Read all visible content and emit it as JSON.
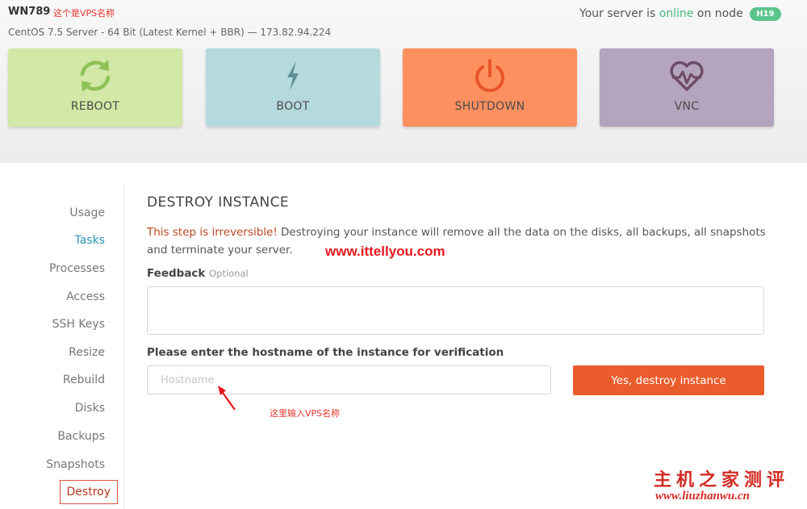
{
  "header": {
    "vps_name": "WN789",
    "vps_name_note": "这个是VPS名称",
    "os_line": "CentOS 7.5 Server - 64 Bit (Latest Kernel + BBR) — 173.82.94.224",
    "status_prefix": "Your server is",
    "status_value": "online",
    "status_suffix": "on node",
    "node": "H19"
  },
  "actions": [
    {
      "label": "REBOOT",
      "icon": "reboot-icon",
      "color": "#d2e8a6"
    },
    {
      "label": "BOOT",
      "icon": "lightning-icon",
      "color": "#b5dade"
    },
    {
      "label": "SHUTDOWN",
      "icon": "power-icon",
      "color": "#fe9060"
    },
    {
      "label": "VNC",
      "icon": "heart-monitor-icon",
      "color": "#b4a4bd"
    }
  ],
  "sidebar": {
    "items": [
      "Usage",
      "Tasks",
      "Processes",
      "Access",
      "SSH Keys",
      "Resize",
      "Rebuild",
      "Disks",
      "Backups",
      "Snapshots",
      "Destroy"
    ],
    "active": "Tasks",
    "selected": "Destroy"
  },
  "main": {
    "title": "DESTROY INSTANCE",
    "warning_strong": "This step is irreversible!",
    "warning_rest": " Destroying your instance will remove all the data on the disks, all backups, all snapshots and terminate your server.",
    "feedback_label": "Feedback",
    "feedback_optional": "Optional",
    "feedback_value": "",
    "hostname_label": "Please enter the hostname of the instance for verification",
    "hostname_placeholder": "Hostname",
    "hostname_value": "",
    "destroy_button": "Yes, destroy instance"
  },
  "annotations": {
    "watermark_url": "www.ittellyou.com",
    "hostname_note": "这里输入VPS名称",
    "brand_text": "主机之家测评",
    "brand_url": "www.liuzhanwu.cn"
  },
  "colors": {
    "online": "#48b97a",
    "accent": "#2b94b6",
    "danger": "#ea5c2c",
    "annotation_red": "#e8322b"
  }
}
